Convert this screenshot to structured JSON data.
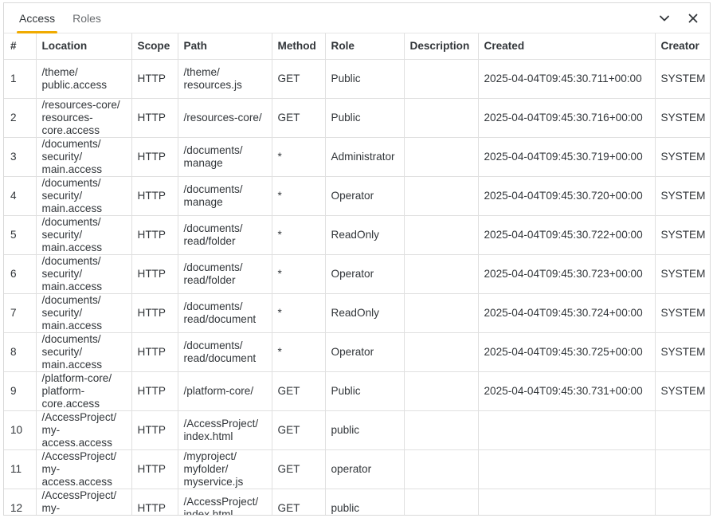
{
  "tabs": [
    {
      "label": "Access",
      "active": true
    },
    {
      "label": "Roles",
      "active": false
    }
  ],
  "actions": {
    "collapse_icon": "chevron-down-icon",
    "close_icon": "close-icon"
  },
  "accent_color": "#f0ab00",
  "table": {
    "columns": [
      "#",
      "Location",
      "Scope",
      "Path",
      "Method",
      "Role",
      "Description",
      "Created",
      "Creator"
    ],
    "rows": [
      {
        "num": "1",
        "location": "/theme/public.access",
        "scope": "HTTP",
        "path": "/theme/resources.js",
        "method": "GET",
        "role": "Public",
        "description": "",
        "created": "2025-04-04T09:45:30.711+00:00",
        "creator": "SYSTEM"
      },
      {
        "num": "2",
        "location": "/resources-core/resources-core.access",
        "scope": "HTTP",
        "path": "/resources-core/",
        "method": "GET",
        "role": "Public",
        "description": "",
        "created": "2025-04-04T09:45:30.716+00:00",
        "creator": "SYSTEM"
      },
      {
        "num": "3",
        "location": "/documents/security/main.access",
        "scope": "HTTP",
        "path": "/documents/manage",
        "method": "*",
        "role": "Administrator",
        "description": "",
        "created": "2025-04-04T09:45:30.719+00:00",
        "creator": "SYSTEM"
      },
      {
        "num": "4",
        "location": "/documents/security/main.access",
        "scope": "HTTP",
        "path": "/documents/manage",
        "method": "*",
        "role": "Operator",
        "description": "",
        "created": "2025-04-04T09:45:30.720+00:00",
        "creator": "SYSTEM"
      },
      {
        "num": "5",
        "location": "/documents/security/main.access",
        "scope": "HTTP",
        "path": "/documents/read/folder",
        "method": "*",
        "role": "ReadOnly",
        "description": "",
        "created": "2025-04-04T09:45:30.722+00:00",
        "creator": "SYSTEM"
      },
      {
        "num": "6",
        "location": "/documents/security/main.access",
        "scope": "HTTP",
        "path": "/documents/read/folder",
        "method": "*",
        "role": "Operator",
        "description": "",
        "created": "2025-04-04T09:45:30.723+00:00",
        "creator": "SYSTEM"
      },
      {
        "num": "7",
        "location": "/documents/security/main.access",
        "scope": "HTTP",
        "path": "/documents/read/document",
        "method": "*",
        "role": "ReadOnly",
        "description": "",
        "created": "2025-04-04T09:45:30.724+00:00",
        "creator": "SYSTEM"
      },
      {
        "num": "8",
        "location": "/documents/security/main.access",
        "scope": "HTTP",
        "path": "/documents/read/document",
        "method": "*",
        "role": "Operator",
        "description": "",
        "created": "2025-04-04T09:45:30.725+00:00",
        "creator": "SYSTEM"
      },
      {
        "num": "9",
        "location": "/platform-core/platform-core.access",
        "scope": "HTTP",
        "path": "/platform-core/",
        "method": "GET",
        "role": "Public",
        "description": "",
        "created": "2025-04-04T09:45:30.731+00:00",
        "creator": "SYSTEM"
      },
      {
        "num": "10",
        "location": "/AccessProject/my-access.access",
        "scope": "HTTP",
        "path": "/AccessProject/index.html",
        "method": "GET",
        "role": "public",
        "description": "",
        "created": "",
        "creator": ""
      },
      {
        "num": "11",
        "location": "/AccessProject/my-access.access",
        "scope": "HTTP",
        "path": "/myproject/myfolder/myservice.js",
        "method": "GET",
        "role": "operator",
        "description": "",
        "created": "",
        "creator": ""
      },
      {
        "num": "12",
        "location": "/AccessProject/my-access.access",
        "scope": "HTTP",
        "path": "/AccessProject/index.html",
        "method": "GET",
        "role": "public",
        "description": "",
        "created": "",
        "creator": ""
      }
    ]
  }
}
